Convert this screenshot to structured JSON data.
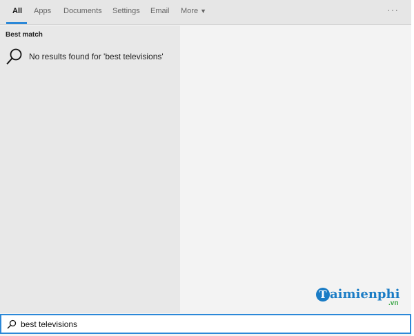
{
  "tabs": [
    {
      "label": "All"
    },
    {
      "label": "Apps"
    },
    {
      "label": "Documents"
    },
    {
      "label": "Settings"
    },
    {
      "label": "Email"
    },
    {
      "label": "More"
    }
  ],
  "more_options_label": "···",
  "results": {
    "section_title": "Best match",
    "message": "No results found for 'best televisions'"
  },
  "watermark": {
    "brand": "aimienphi",
    "initial": "T",
    "suffix": ".vn"
  },
  "search": {
    "value": "best televisions"
  }
}
